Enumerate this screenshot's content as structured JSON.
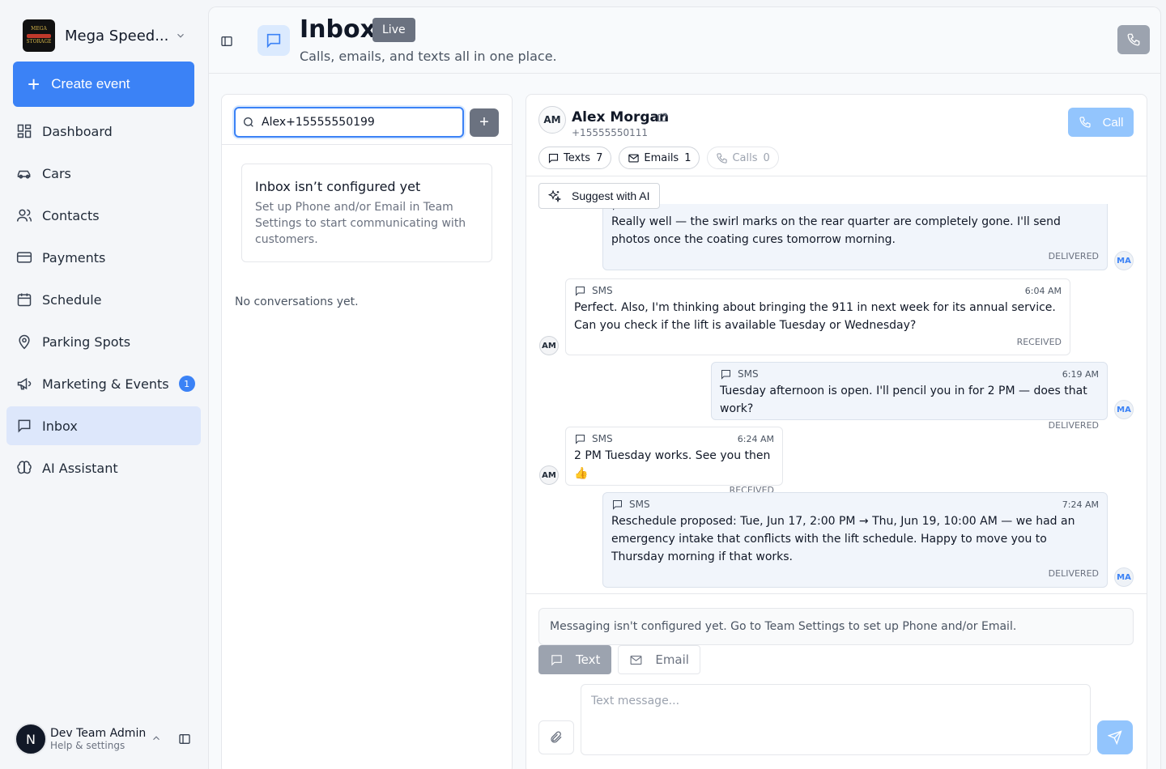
{
  "sidebar": {
    "org_name": "Mega Speed...",
    "create_label": "Create event",
    "items": [
      {
        "label": "Dashboard",
        "icon": "dashboard-icon"
      },
      {
        "label": "Cars",
        "icon": "car-icon"
      },
      {
        "label": "Contacts",
        "icon": "users-icon"
      },
      {
        "label": "Payments",
        "icon": "credit-card-icon"
      },
      {
        "label": "Schedule",
        "icon": "calendar-icon"
      },
      {
        "label": "Parking Spots",
        "icon": "map-pin-icon"
      },
      {
        "label": "Marketing & Events",
        "icon": "megaphone-icon",
        "badge": "1"
      },
      {
        "label": "Inbox",
        "icon": "message-square-icon",
        "active": true
      },
      {
        "label": "AI Assistant",
        "icon": "brain-icon"
      }
    ],
    "user": {
      "initial": "N",
      "name": "Dev Team Admin",
      "sub": "Help & settings"
    }
  },
  "header": {
    "title": "Inbox",
    "badge": "Live",
    "subtitle": "Calls, emails, and texts all in one place."
  },
  "list": {
    "search_value": "Alex+15555550199",
    "notice_title": "Inbox isn’t configured yet",
    "notice_body": "Set up Phone and/or Email in Team Settings to start communicating with customers.",
    "empty": "No conversations yet."
  },
  "thread": {
    "contact": {
      "initials": "AM",
      "name": "Alex Morgan",
      "phone": "+15555550111"
    },
    "call_label": "Call",
    "chips": [
      {
        "label": "Texts",
        "count": "7"
      },
      {
        "label": "Emails",
        "count": "1"
      },
      {
        "label": "Calls",
        "count": "0"
      }
    ],
    "suggest_label": "Suggest with AI",
    "messages": [
      {
        "channel": "SMS",
        "time": "",
        "body": "Really well — the swirl marks on the rear quarter are completely gone. I'll send photos once the coating cures tomorrow morning.",
        "status": "DELIVERED",
        "author": "MA"
      },
      {
        "channel": "SMS",
        "time": "6:04 AM",
        "body": "Perfect. Also, I'm thinking about bringing the 911 in next week for its annual service. Can you check if the lift is available Tuesday or Wednesday?",
        "status": "RECEIVED",
        "author": "AM"
      },
      {
        "channel": "SMS",
        "time": "6:19 AM",
        "body": "Tuesday afternoon is open. I'll pencil you in for 2 PM — does that work?",
        "status": "DELIVERED",
        "author": "MA"
      },
      {
        "channel": "SMS",
        "time": "6:24 AM",
        "body": "2 PM Tuesday works. See you then 👍",
        "status": "RECEIVED",
        "author": "AM"
      },
      {
        "channel": "SMS",
        "time": "7:24 AM",
        "body": "Reschedule proposed: Tue, Jun 17, 2:00 PM → Thu, Jun 19, 10:00 AM — we had an emergency intake that conflicts with the lift schedule. Happy to move you to Thursday morning if that works.",
        "status": "DELIVERED",
        "author": "MA"
      }
    ],
    "config_notice": "Messaging isn't configured yet. Go to Team Settings to set up Phone and/or Email.",
    "modes": [
      "Text",
      "Email"
    ],
    "compose_placeholder": "Text message..."
  },
  "colors": {
    "accent": "#3b82f6",
    "active_nav": "#dde7fb",
    "outgoing_bubble": "#f1f5fb"
  }
}
